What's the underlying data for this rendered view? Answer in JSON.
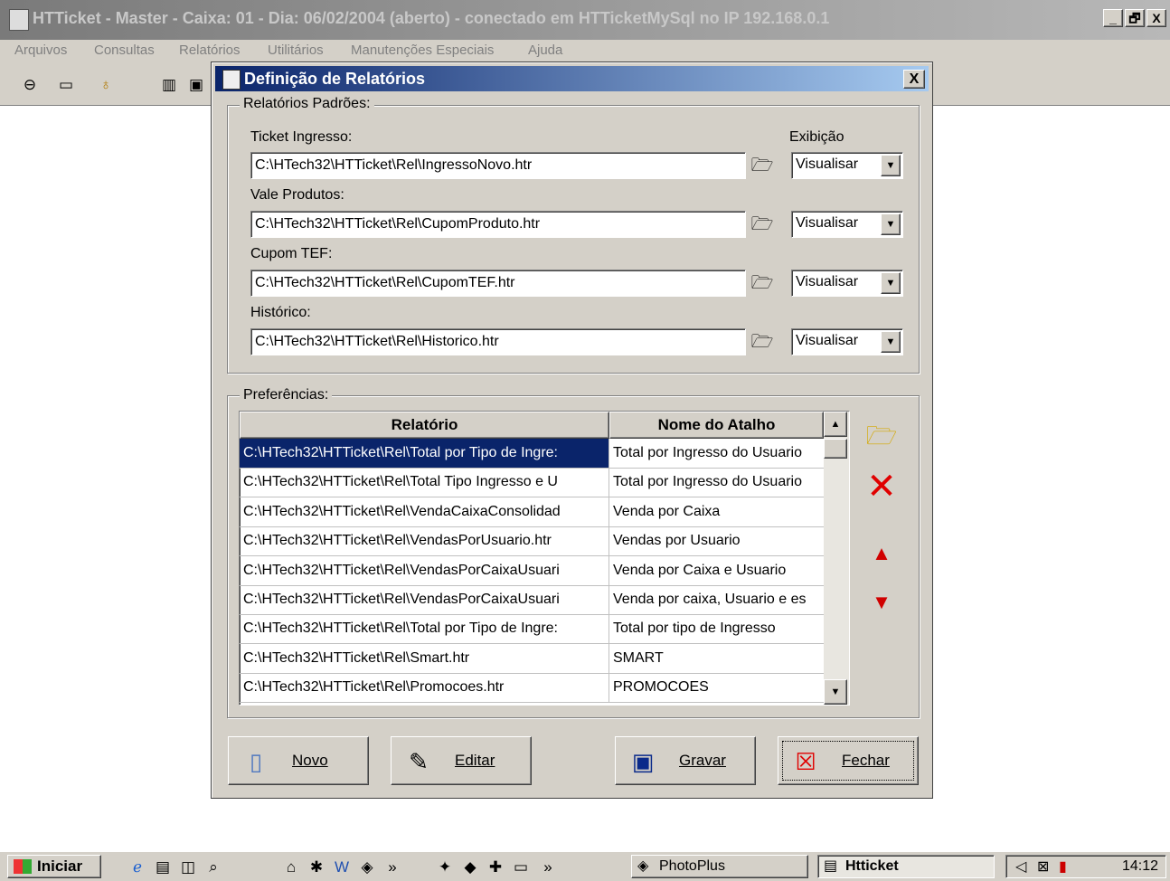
{
  "app": {
    "title": "HTTicket - Master - Caixa: 01 - Dia: 06/02/2004 (aberto) - conectado em HTTicketMySql no IP 192.168.0.1",
    "window_buttons": [
      "_",
      "🗗",
      "X"
    ]
  },
  "menu": [
    "Arquivos",
    "Consultas",
    "Relatórios",
    "Utilitários",
    "Manutenções Especiais",
    "Ajuda"
  ],
  "dialog": {
    "title": "Definição de Relatórios",
    "close": "X",
    "padroes": {
      "label": "Relatórios Padrões:",
      "exibicao_label": "Exibição",
      "fields": [
        {
          "label": "Ticket Ingresso:",
          "path": "C:\\HTech32\\HTTicket\\Rel\\IngressoNovo.htr",
          "mode": "Visualisar"
        },
        {
          "label": "Vale Produtos:",
          "path": "C:\\HTech32\\HTTicket\\Rel\\CupomProduto.htr",
          "mode": "Visualisar"
        },
        {
          "label": "Cupom TEF:",
          "path": "C:\\HTech32\\HTTicket\\Rel\\CupomTEF.htr",
          "mode": "Visualisar"
        },
        {
          "label": "Histórico:",
          "path": "C:\\HTech32\\HTTicket\\Rel\\Historico.htr",
          "mode": "Visualisar"
        }
      ]
    },
    "preferencias": {
      "label": "Preferências:",
      "columns": [
        "Relatório",
        "Nome do Atalho"
      ],
      "rows": [
        {
          "rel": "C:\\HTech32\\HTTicket\\Rel\\Total por Tipo de Ingre:",
          "nome": "Total por Ingresso do Usuario"
        },
        {
          "rel": "C:\\HTech32\\HTTicket\\Rel\\Total Tipo Ingresso e U",
          "nome": "Total por Ingresso do Usuario"
        },
        {
          "rel": "C:\\HTech32\\HTTicket\\Rel\\VendaCaixaConsolidad",
          "nome": "Venda por Caixa"
        },
        {
          "rel": "C:\\HTech32\\HTTicket\\Rel\\VendasPorUsuario.htr",
          "nome": "Vendas por Usuario"
        },
        {
          "rel": "C:\\HTech32\\HTTicket\\Rel\\VendasPorCaixaUsuari",
          "nome": "Venda por Caixa e Usuario"
        },
        {
          "rel": "C:\\HTech32\\HTTicket\\Rel\\VendasPorCaixaUsuari",
          "nome": "Venda por caixa, Usuario e es"
        },
        {
          "rel": "C:\\HTech32\\HTTicket\\Rel\\Total por Tipo de Ingre:",
          "nome": "Total por tipo de Ingresso"
        },
        {
          "rel": "C:\\HTech32\\HTTicket\\Rel\\Smart.htr",
          "nome": "SMART"
        },
        {
          "rel": "C:\\HTech32\\HTTicket\\Rel\\Promocoes.htr",
          "nome": "PROMOCOES"
        }
      ],
      "selected_index": 0
    },
    "buttons": {
      "novo": "Novo",
      "editar": "Editar",
      "gravar": "Gravar",
      "fechar": "Fechar"
    }
  },
  "taskbar": {
    "start": "Iniciar",
    "tasks": [
      "PhotoPlus",
      "Htticket"
    ],
    "time": "14:12"
  },
  "colors": {
    "selection": "#0a246a",
    "title_active": "#0a246a",
    "face": "#d4d0c8"
  }
}
